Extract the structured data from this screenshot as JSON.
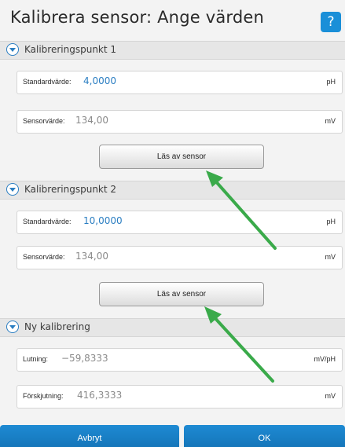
{
  "dialog": {
    "title": "Kalibrera sensor: Ange värden",
    "help_label": "?"
  },
  "sections": [
    {
      "label": "Kalibreringspunkt 1",
      "fields": [
        {
          "label": "Standardvärde:",
          "value": "4,0000",
          "unit": "pH"
        },
        {
          "label": "Sensorvärde:",
          "value": "134,00",
          "unit": "mV"
        }
      ],
      "button_label": "Läs av sensor"
    },
    {
      "label": "Kalibreringspunkt 2",
      "fields": [
        {
          "label": "Standardvärde:",
          "value": "10,0000",
          "unit": "pH"
        },
        {
          "label": "Sensorvärde:",
          "value": "134,00",
          "unit": "mV"
        }
      ],
      "button_label": "Läs av sensor"
    },
    {
      "label": "Ny kalibrering",
      "fields": [
        {
          "label": "Lutning:",
          "value": "−59,8333",
          "unit": "mV/pH"
        },
        {
          "label": "Förskjutning:",
          "value": "416,3333",
          "unit": "mV"
        }
      ]
    }
  ],
  "footer": {
    "cancel_label": "Avbryt",
    "ok_label": "OK"
  },
  "colors": {
    "accent": "#1a8fd8",
    "arrow": "#3aaa4a",
    "value_blue": "#2b7ec2"
  },
  "icons": {
    "section_toggle": "chevron-down-circle-icon",
    "help": "help-icon",
    "annotation": "green-arrow-icon"
  }
}
